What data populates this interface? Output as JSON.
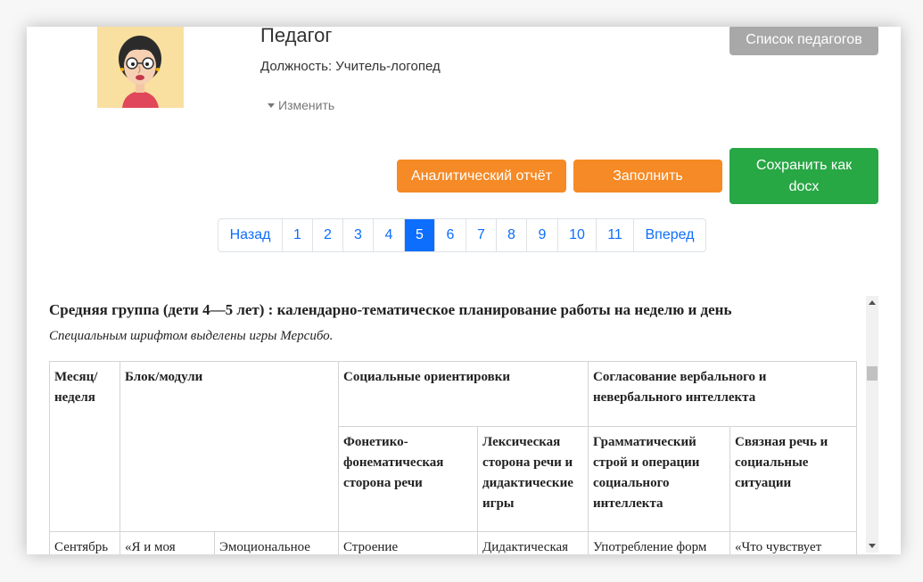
{
  "profile": {
    "title": "Педагог",
    "position_label": "Должность:",
    "position_value": "Учитель-логопед",
    "edit_label": "Изменить"
  },
  "buttons": {
    "teacher_list": "Список педагогов",
    "analytic_report": "Аналитический отчёт",
    "fill": "Заполнить",
    "save_docx": "Сохранить как docx"
  },
  "pagination": {
    "prev": "Назад",
    "pages": [
      "1",
      "2",
      "3",
      "4",
      "5",
      "6",
      "7",
      "8",
      "9",
      "10",
      "11"
    ],
    "active": "5",
    "next": "Вперед"
  },
  "document": {
    "title": "Средняя группа (дети 4—5 лет) : календарно-тематическое планирование работы на неделю и день",
    "note": "Специальным шрифтом выделены игры Мерсибо.",
    "table": {
      "month_week": "Месяц/ неделя",
      "blocks": "Блок/модули",
      "social": "Социальные ориентировки",
      "verbal": "Согласование вербального и невербального интеллекта",
      "phonetic": "Фонетико-фонематическая сторона речи",
      "lexical": "Лексическая сторона речи и дидактические игры",
      "grammar": "Грамматический строй и операции социального интеллекта",
      "coherent": "Связная речь и социальные ситуации",
      "row1": [
        "Сентябрь",
        "«Я и моя",
        "Эмоциональное",
        "Строение",
        "Дидактическая",
        "Употребление форм",
        "«Что чувствует"
      ]
    }
  }
}
